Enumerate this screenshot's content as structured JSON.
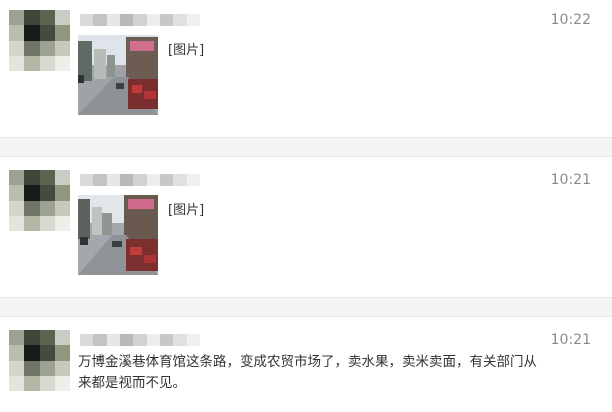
{
  "posts": [
    {
      "time": "10:22",
      "image_label": "[图片]"
    },
    {
      "time": "10:21",
      "image_label": "[图片]"
    },
    {
      "time": "10:21",
      "text_line1": "万博金溪巷体育馆这条路，变成农贸市场了，卖水果，卖米卖面，有关部门从",
      "text_line2": "来都是视而不见。"
    }
  ],
  "colors": {
    "background": "#ffffff",
    "separator": "#f4f4f4",
    "time_text": "#8a8a8a",
    "body_text": "#333333"
  }
}
